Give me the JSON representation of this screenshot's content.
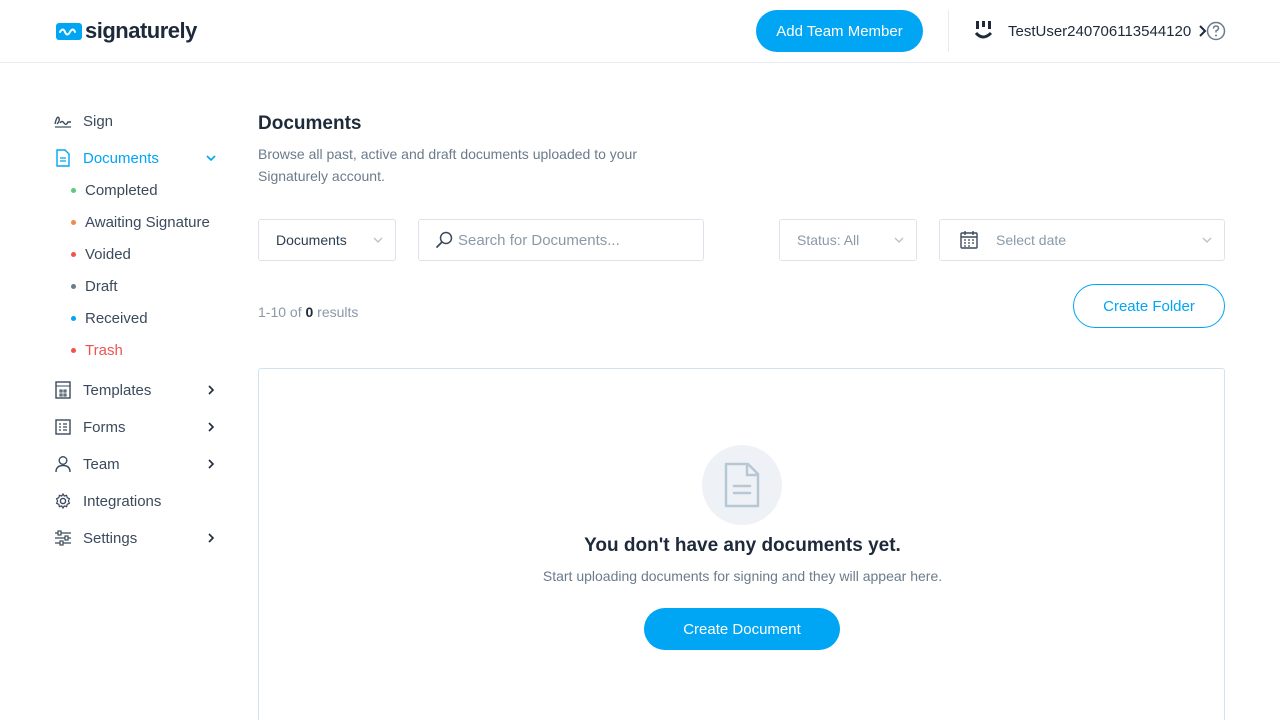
{
  "brand": {
    "name": "signaturely",
    "accent": "#00a5f4"
  },
  "header": {
    "add_member_label": "Add Team Member",
    "username": "TestUser240706113544120"
  },
  "sidebar": {
    "items": [
      {
        "label": "Sign",
        "icon": "signature-icon"
      },
      {
        "label": "Documents",
        "icon": "document-icon",
        "active": true,
        "expanded": true
      },
      {
        "label": "Templates",
        "icon": "template-icon"
      },
      {
        "label": "Forms",
        "icon": "form-icon"
      },
      {
        "label": "Team",
        "icon": "user-icon"
      },
      {
        "label": "Integrations",
        "icon": "gear-icon"
      },
      {
        "label": "Settings",
        "icon": "sliders-icon"
      }
    ],
    "subitems": [
      {
        "label": "Completed",
        "color": "#5cc97b"
      },
      {
        "label": "Awaiting Signature",
        "color": "#f08a4b"
      },
      {
        "label": "Voided",
        "color": "#ef5350"
      },
      {
        "label": "Draft",
        "color": "#6b7b8c"
      },
      {
        "label": "Received",
        "color": "#00a5f4"
      },
      {
        "label": "Trash",
        "color": "#ef5350"
      }
    ]
  },
  "main": {
    "title": "Documents",
    "description": "Browse all past, active and draft documents uploaded to your Signaturely account.",
    "filter_type": "Documents",
    "search_placeholder": "Search for Documents...",
    "status_filter": "Status: All",
    "date_placeholder": "Select date",
    "results_prefix": "1-10 of",
    "results_count": "0",
    "results_suffix": "results",
    "create_folder_label": "Create Folder",
    "empty": {
      "title": "You don't have any documents yet.",
      "subtitle": "Start uploading documents for signing and they will appear here.",
      "create_label": "Create Document"
    }
  }
}
